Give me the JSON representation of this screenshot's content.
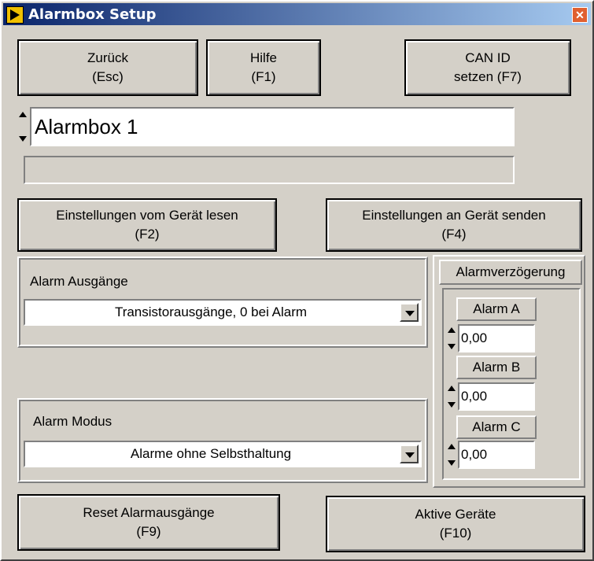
{
  "window": {
    "title": "Alarmbox Setup"
  },
  "buttons": {
    "back": {
      "line1": "Zurück",
      "line2": "(Esc)"
    },
    "help": {
      "line1": "Hilfe",
      "line2": "(F1)"
    },
    "can_id": {
      "line1": "CAN ID",
      "line2": "setzen (F7)"
    },
    "read_settings": {
      "line1": "Einstellungen vom Gerät lesen",
      "line2": "(F2)"
    },
    "send_settings": {
      "line1": "Einstellungen an Gerät senden",
      "line2": "(F4)"
    },
    "reset_outputs": {
      "line1": "Reset Alarmausgänge",
      "line2": "(F9)"
    },
    "active_devices": {
      "line1": "Aktive Geräte",
      "line2": "(F10)"
    }
  },
  "device": {
    "name": "Alarmbox 1",
    "status": ""
  },
  "alarm_outputs": {
    "label": "Alarm Ausgänge",
    "selected": "Transistorausgänge, 0 bei Alarm"
  },
  "alarm_mode": {
    "label": "Alarm Modus",
    "selected": "Alarme ohne Selbsthaltung"
  },
  "delay": {
    "title": "Alarmverzögerung",
    "alarms": [
      {
        "label": "Alarm A",
        "value": "0,00"
      },
      {
        "label": "Alarm B",
        "value": "0,00"
      },
      {
        "label": "Alarm C",
        "value": "0,00"
      }
    ]
  }
}
